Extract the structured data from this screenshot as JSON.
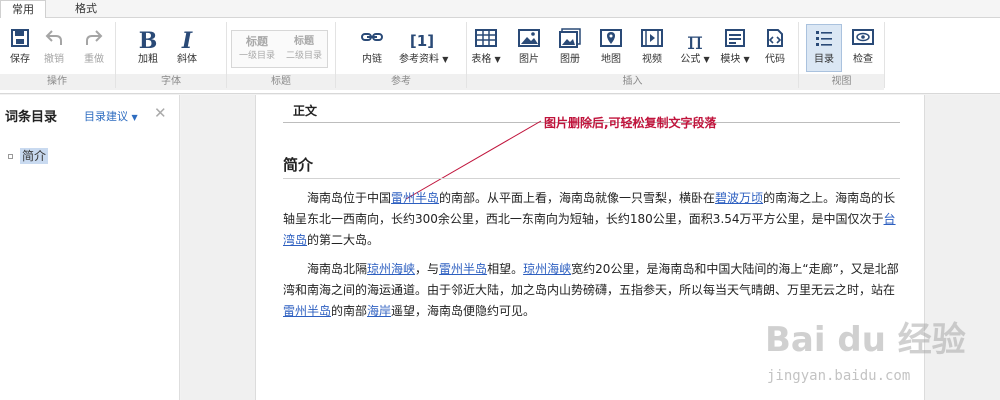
{
  "tabs": [
    {
      "label": "常用",
      "active": true
    },
    {
      "label": "格式",
      "active": false
    }
  ],
  "toolbar": {
    "save": "保存",
    "undo": "撤销",
    "redo": "重做",
    "bold": "加粗",
    "italic": "斜体",
    "heading1_title": "标题",
    "heading1_sub": "一级目录",
    "heading2_title": "标题",
    "heading2_sub": "二级目录",
    "inner_link": "内链",
    "reference": "参考资料",
    "reference_glyph": "[1]",
    "table": "表格",
    "image": "图片",
    "gallery": "图册",
    "map": "地图",
    "video": "视频",
    "formula": "公式",
    "module": "模块",
    "code": "代码",
    "toc": "目录",
    "check": "检查"
  },
  "groups": {
    "operation": "操作",
    "font": "字体",
    "heading": "标题",
    "reference": "参考",
    "insert": "插入",
    "view": "视图"
  },
  "sidebar": {
    "title": "词条目录",
    "suggest": "目录建议",
    "items": [
      "简介"
    ]
  },
  "doc": {
    "body_label": "正文",
    "annotation": "图片删除后,可轻松复制文字段落",
    "section_title": "简介",
    "p1": [
      {
        "t": "海南岛位于中国"
      },
      {
        "t": "雷州半岛",
        "link": true
      },
      {
        "t": "的南部。从平面上看，海南岛就像一只雪梨，横卧在"
      },
      {
        "t": "碧波万顷",
        "link": true
      },
      {
        "t": "的南海之上。海南岛的长轴呈东北一西南向，长约300余公里，西北一东南向为短轴，长约180公里，面积3.54万平方公里，是中国仅次于"
      },
      {
        "t": "台湾岛",
        "link": true
      },
      {
        "t": "的第二大岛。"
      }
    ],
    "p2": [
      {
        "t": "海南岛北隔"
      },
      {
        "t": "琼州海峡",
        "link": true
      },
      {
        "t": "，与"
      },
      {
        "t": "雷州半岛",
        "link": true
      },
      {
        "t": "相望。"
      },
      {
        "t": "琼州海峡",
        "link": true
      },
      {
        "t": "宽约20公里，是海南岛和中国大陆间的海上“走廊”，又是北部湾和南海之间的海运通道。由于邻近大陆，加之岛内山势磅礴，五指参天，所以每当天气晴朗、万里无云之时，站在"
      },
      {
        "t": "雷州半岛",
        "link": true
      },
      {
        "t": "的南部"
      },
      {
        "t": "海岸",
        "link": true
      },
      {
        "t": "遥望，海南岛便隐约可见。"
      }
    ]
  },
  "watermark": {
    "logo": "Bai du 经验",
    "url": "jingyan.baidu.com"
  },
  "colors": {
    "accent": "#2d6cc0",
    "annotation": "#c0143c",
    "link": "#2d5fc0",
    "icon": "#2a4a77"
  }
}
